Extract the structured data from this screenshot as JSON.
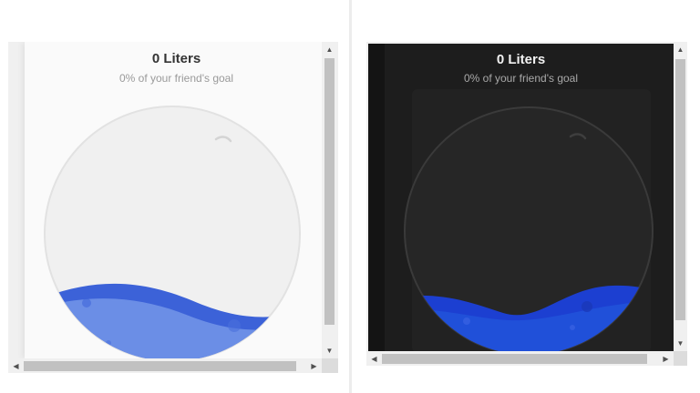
{
  "panels": [
    {
      "theme": "light",
      "amount_label": "0 Liters",
      "goal_label": "0% of your friend's goal",
      "progress_fraction": 0,
      "colors": {
        "background": "#fafafa",
        "bowl": "#f0f0f0",
        "water_back": "#3c62d8",
        "water_front": "#6b8ee6"
      }
    },
    {
      "theme": "dark",
      "amount_label": "0 Liters",
      "goal_label": "0% of your friend's goal",
      "progress_fraction": 0,
      "colors": {
        "background": "#1d1d1d",
        "bowl": "#262626",
        "water_back": "#1c3fd1",
        "water_front": "#2050d9"
      }
    }
  ],
  "scrollbar_glyphs": {
    "up": "▲",
    "down": "▼",
    "left": "◀",
    "right": "▶"
  }
}
